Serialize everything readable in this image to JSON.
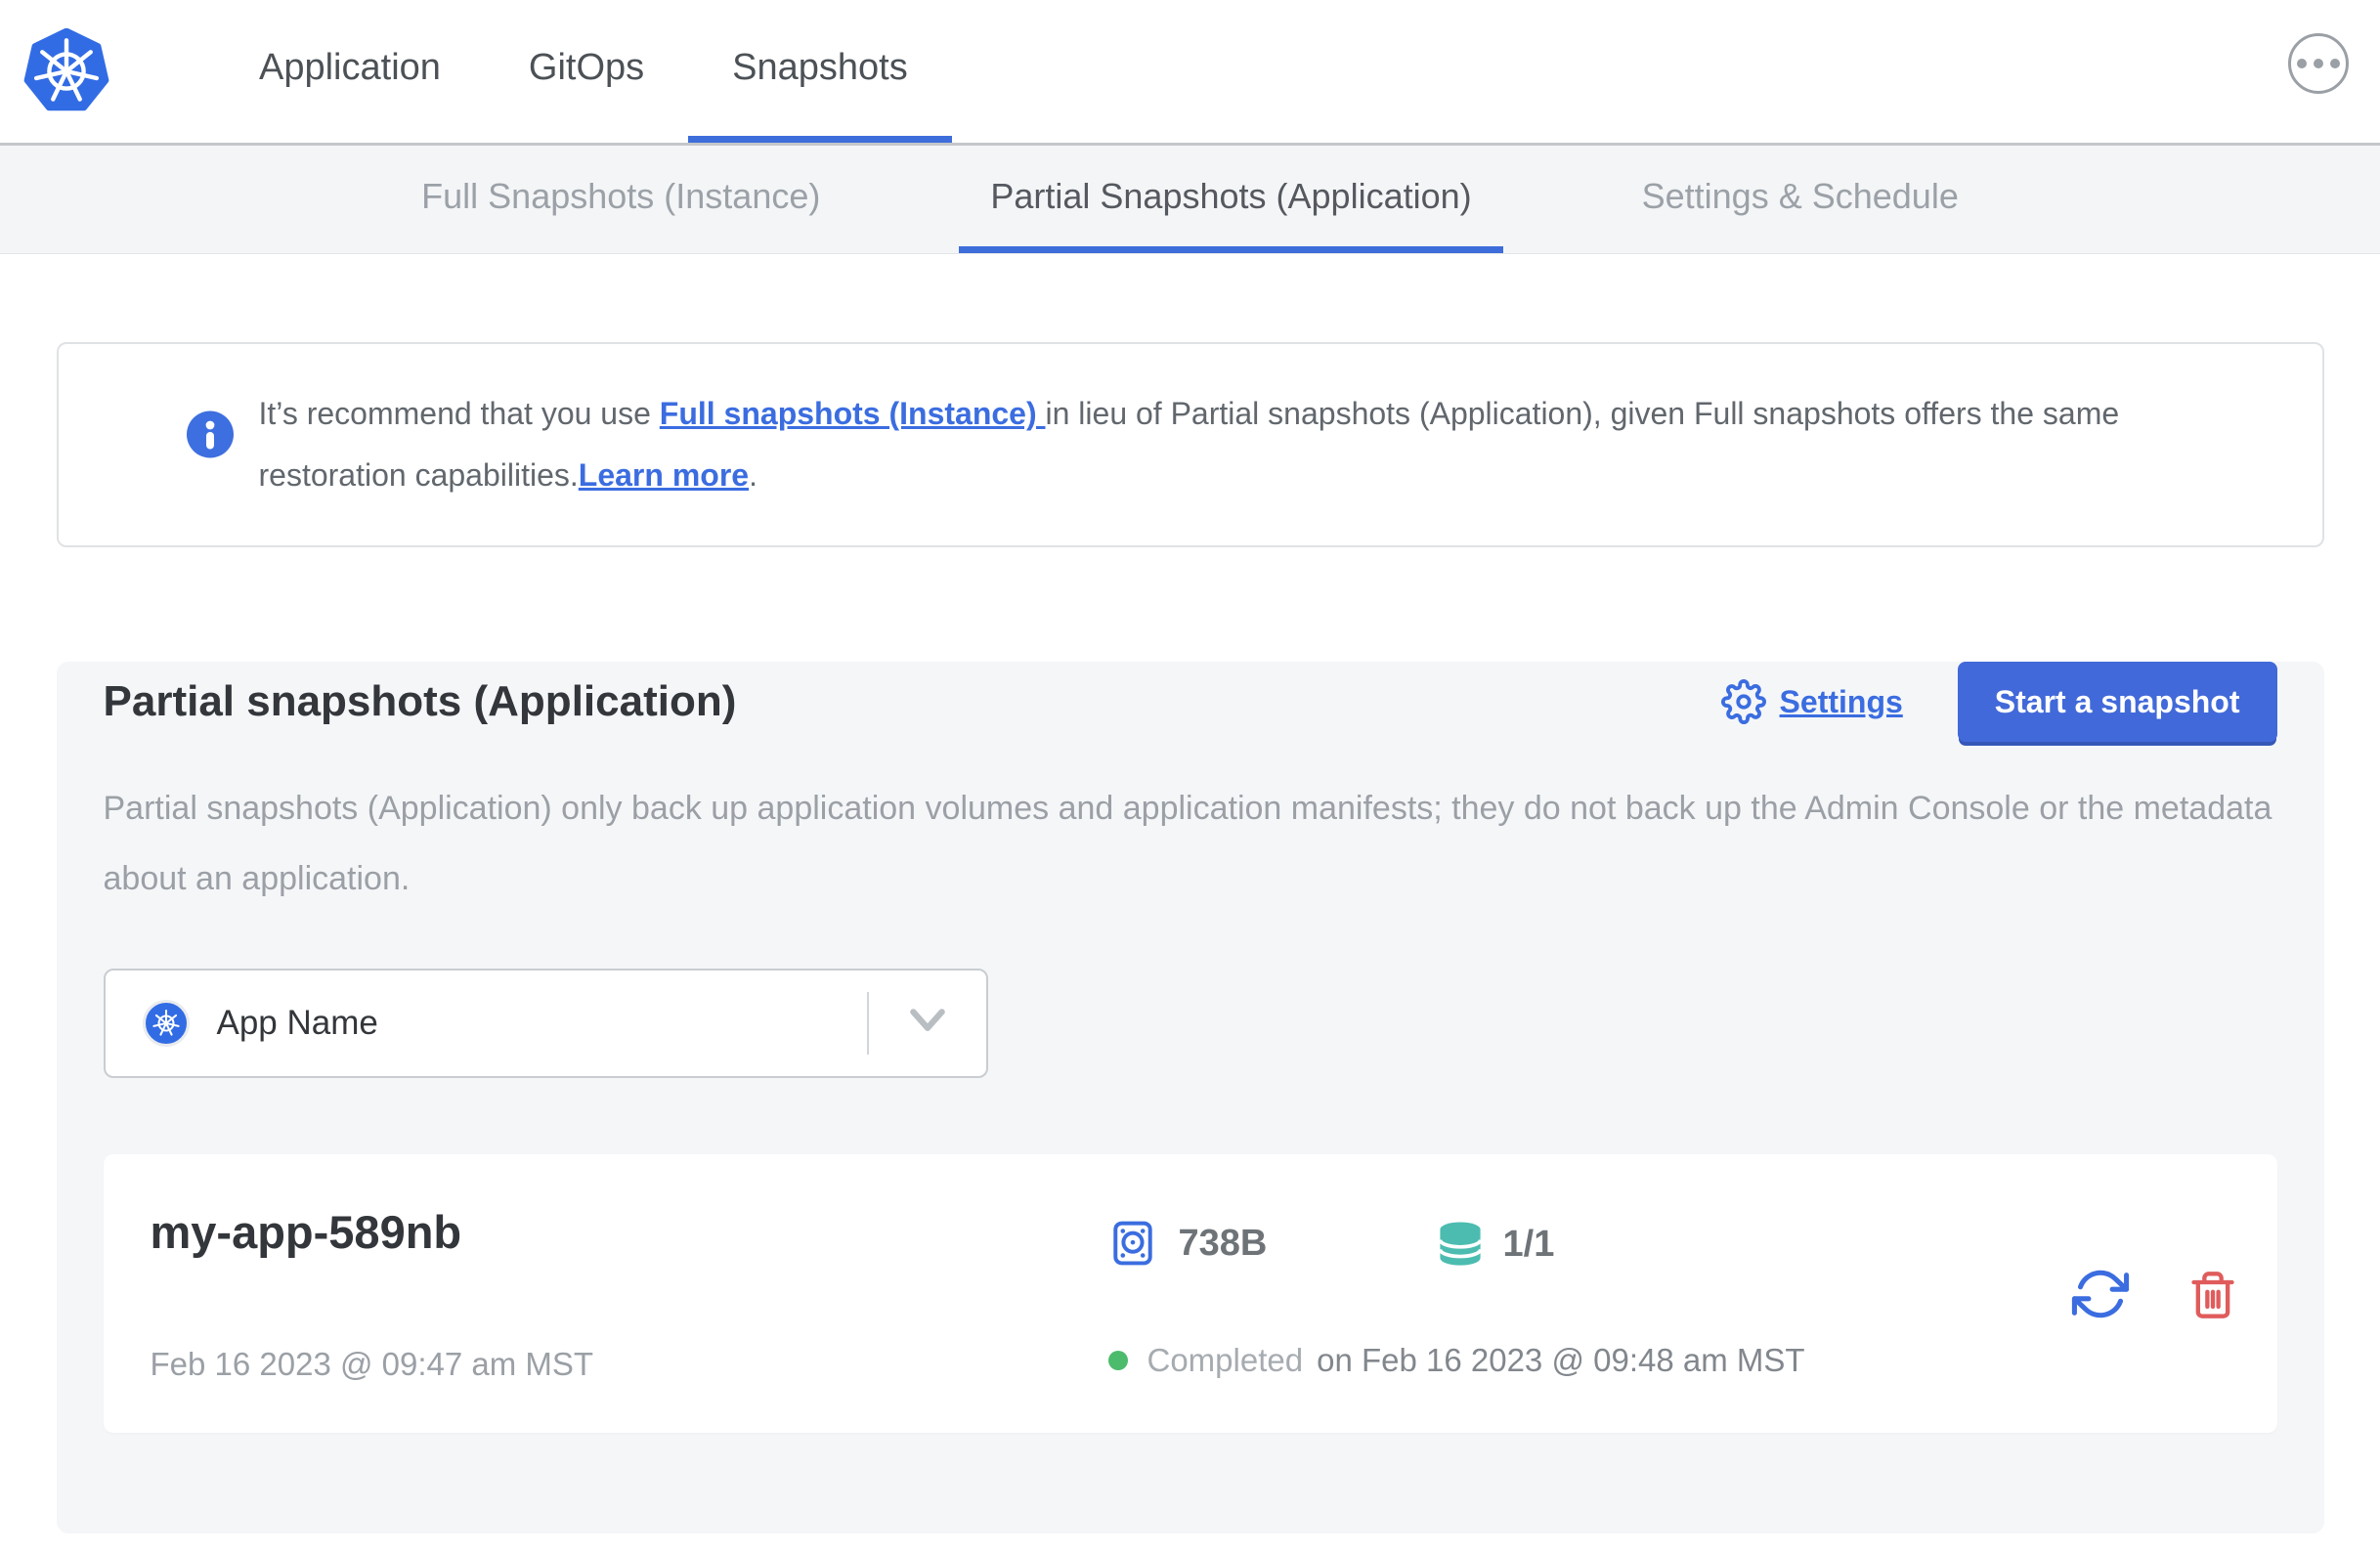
{
  "header": {
    "nav": [
      {
        "label": "Application",
        "active": false
      },
      {
        "label": "GitOps",
        "active": false
      },
      {
        "label": "Snapshots",
        "active": true
      }
    ]
  },
  "subnav": {
    "tabs": [
      {
        "label": "Full Snapshots (Instance)",
        "active": false
      },
      {
        "label": "Partial Snapshots (Application)",
        "active": true
      },
      {
        "label": "Settings & Schedule",
        "active": false
      }
    ]
  },
  "banner": {
    "text_before": "It’s recommend that you use ",
    "link_full_snapshots": "Full snapshots (Instance) ",
    "text_middle": "in lieu of Partial snapshots (Application), given Full snapshots offers the same restoration capabilities.",
    "link_learn_more": "Learn more",
    "text_after": "."
  },
  "panel": {
    "title": "Partial snapshots (Application)",
    "settings_label": "Settings",
    "start_button_label": "Start a snapshot",
    "description": "Partial snapshots (Application) only back up application volumes and application manifests; they do not back up the Admin Console or the metadata about an application.",
    "app_selector": {
      "value": "App Name"
    }
  },
  "snapshot": {
    "name": "my-app-589nb",
    "started": "Feb 16 2023 @ 09:47 am MST",
    "size": "738B",
    "volumes": "1/1",
    "status": "Completed",
    "finished": "on Feb 16 2023 @ 09:48 am MST"
  },
  "icons": {
    "logo": "kubernetes-logo",
    "more": "ellipsis-circle",
    "banner": "info-circle",
    "settings": "gear",
    "selector_left": "kubernetes-mini",
    "selector_right": "chevron-down",
    "size": "disk-drive",
    "volumes": "database",
    "restore": "circular-arrows",
    "delete": "trash"
  },
  "colors": {
    "accent_blue": "#3b6de0",
    "button_blue": "#4169d9",
    "k8s_blue": "#326ce5",
    "teal": "#4cbcb0",
    "red": "#e05c5c",
    "green": "#4cbb6c",
    "panel_bg": "#f5f6f8",
    "subnav_bg": "#f4f5f7"
  }
}
